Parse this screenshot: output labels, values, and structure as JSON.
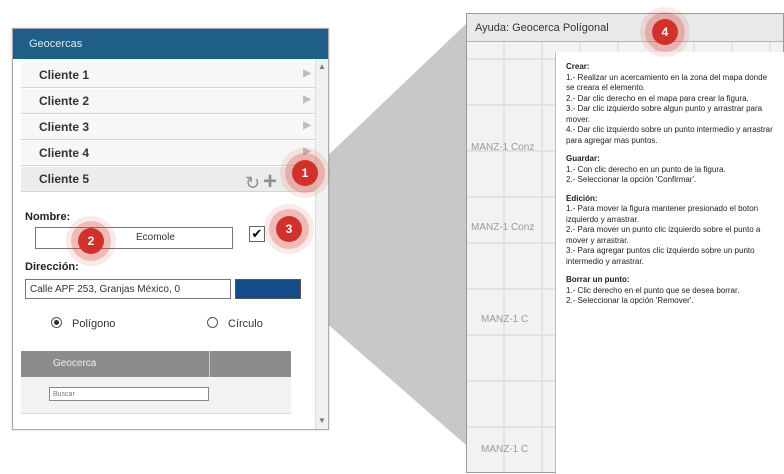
{
  "left_panel": {
    "header": "Geocercas",
    "clients": [
      "Cliente 1",
      "Cliente 2",
      "Cliente 3",
      "Cliente 4",
      "Cliente 5"
    ],
    "name_label": "Nombre:",
    "name_value": "Ecomole",
    "address_label": "Dirección:",
    "address_value": "Calle APF 253, Granjas México, 0",
    "color": "#174c8a",
    "radio_polygon": "Polígono",
    "radio_circle": "Círculo",
    "table_header": "Geocerca",
    "table_filter_placeholder": "Buscar"
  },
  "badges": {
    "b1": "1",
    "b2": "2",
    "b3": "3",
    "b4": "4"
  },
  "right_window": {
    "title": "Ayuda: Geocerca Polígonal",
    "map_labels": [
      "MANZ-1 Conz",
      "MANZ-1 Conz",
      "MANZ-1 C",
      "MANZ-1 C"
    ],
    "help": {
      "crear_title": "Crear:",
      "crear_1": "1.- Realizar un acercamiento en la zona del mapa donde se creara el elemento.",
      "crear_2": "2.- Dar clic derecho en el mapa para crear la figura.",
      "crear_3": "3.- Dar clic izquierdo sobre algun punto y arrastrar para mover.",
      "crear_4": "4.- Dar clic izquierdo sobre un punto intermedio y arrastrar para agregar mas puntos.",
      "guardar_title": "Guardar:",
      "guardar_1": "1.- Con clic derecho en un punto de la figura.",
      "guardar_2": "2.- Seleccionar la opción 'Confirmar'.",
      "edicion_title": "Edición:",
      "edicion_1": "1.- Para mover la figura mantener presionado el boton izquierdo y arrastrar.",
      "edicion_2": "2.- Para mover un punto clic izquierdo sobre el punto a mover y arrastrar.",
      "edicion_3": "3.- Para agregar puntos clic izquierdo sobre un punto intermedio y arrastrar.",
      "borrar_title": "Borrar un punto:",
      "borrar_1": "1.- Clic derecho en el punto que se desea borrar.",
      "borrar_2": "2.- Seleccionar la opción 'Remover'."
    }
  }
}
